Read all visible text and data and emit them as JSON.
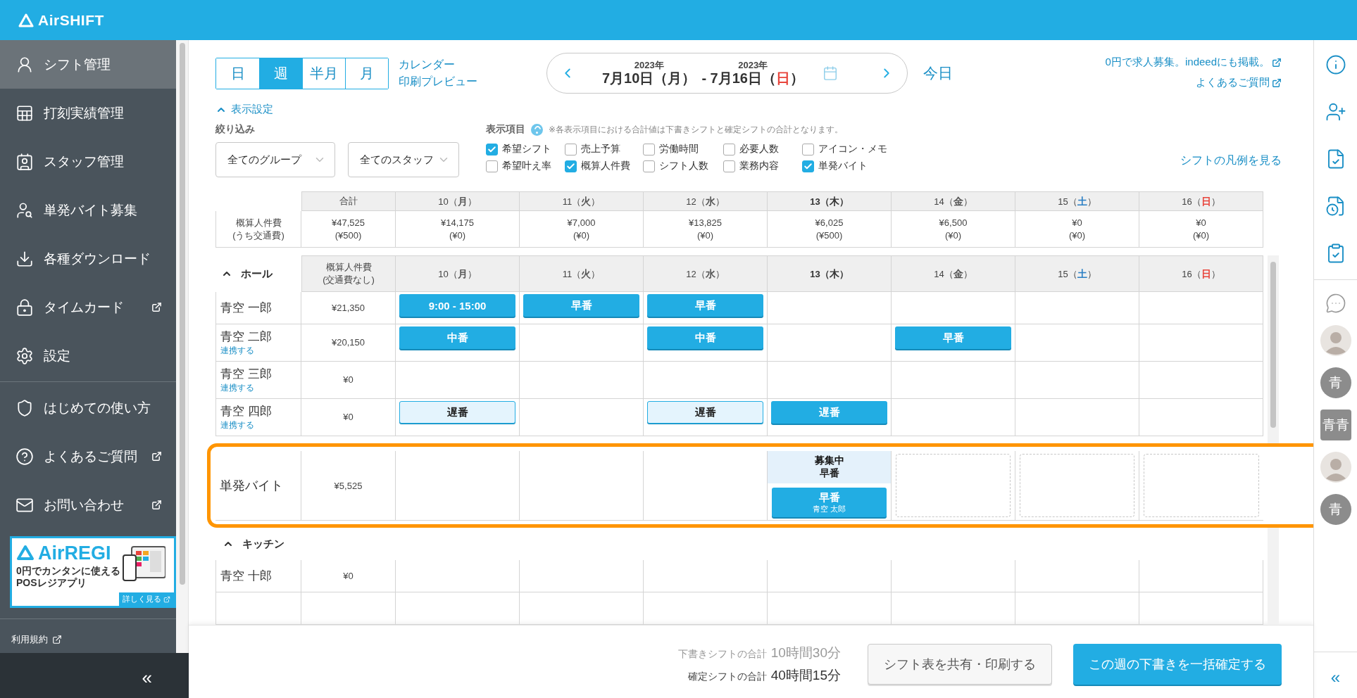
{
  "header": {
    "logo": "AirSHIFT"
  },
  "sidebar": {
    "sections": [
      [
        {
          "label": "シフト管理",
          "selected": true,
          "external": false
        },
        {
          "label": "打刻実績管理",
          "selected": false,
          "external": false
        },
        {
          "label": "スタッフ管理",
          "selected": false,
          "external": false
        },
        {
          "label": "単発バイト募集",
          "selected": false,
          "external": false
        },
        {
          "label": "各種ダウンロード",
          "selected": false,
          "external": false
        },
        {
          "label": "タイムカード",
          "selected": false,
          "external": true
        },
        {
          "label": "設定",
          "selected": false,
          "external": false
        }
      ],
      [
        {
          "label": "はじめての使い方",
          "selected": false,
          "external": false
        },
        {
          "label": "よくあるご質問",
          "selected": false,
          "external": true
        },
        {
          "label": "お問い合わせ",
          "selected": false,
          "external": true
        }
      ]
    ],
    "banner": {
      "brand": "AirREGI",
      "lines": [
        "0円でカンタンに使える",
        "POSレジアプリ"
      ],
      "link": "詳しく見る"
    },
    "footer_link": "利用規約",
    "collapse": "«"
  },
  "toolbar": {
    "view_tabs": [
      {
        "label": "日",
        "selected": false
      },
      {
        "label": "週",
        "selected": true
      },
      {
        "label": "半月",
        "selected": false
      },
      {
        "label": "月",
        "selected": false
      }
    ],
    "print_link": [
      "カレンダー",
      "印刷プレビュー"
    ],
    "range": {
      "start_year": "2023年",
      "start": "7月10日（月）",
      "end_year": "2023年",
      "end": "- 7月16日（",
      "end_weekday": "日",
      "end_close": "）"
    },
    "today": "今日",
    "links": [
      "0円で求人募集。indeedにも掲載。",
      "よくあるご質問"
    ]
  },
  "display_settings": {
    "toggle": "表示設定",
    "expanded": true,
    "filter_label": "絞り込み",
    "filters": [
      "全てのグループ",
      "全てのスタッフ"
    ],
    "items_label": "表示項目",
    "note": "※各表示項目における合計値は下書きシフトと確定シフトの合計となります。",
    "options": [
      {
        "label": "希望シフト",
        "checked": true
      },
      {
        "label": "売上予算",
        "checked": false
      },
      {
        "label": "労働時間",
        "checked": false
      },
      {
        "label": "必要人数",
        "checked": false
      },
      {
        "label": "アイコン・メモ",
        "checked": false
      },
      {
        "label": "希望叶え率",
        "checked": false
      },
      {
        "label": "概算人件費",
        "checked": true
      },
      {
        "label": "シフト人数",
        "checked": false
      },
      {
        "label": "業務内容",
        "checked": false
      },
      {
        "label": "単発バイト",
        "checked": true
      }
    ],
    "legend_link": "シフトの凡例を見る"
  },
  "summary": {
    "total_header": "合計",
    "days": [
      {
        "day": "10（",
        "weekday": "月",
        "close": "）",
        "color": "#555555",
        "today": false
      },
      {
        "day": "11（",
        "weekday": "火",
        "close": "）",
        "color": "#555555",
        "today": false
      },
      {
        "day": "12（",
        "weekday": "水",
        "close": "）",
        "color": "#555555",
        "today": false
      },
      {
        "day": "13（",
        "weekday": "木",
        "close": "）",
        "color": "#333333",
        "today": true
      },
      {
        "day": "14（",
        "weekday": "金",
        "close": "）",
        "color": "#555555",
        "today": false
      },
      {
        "day": "15（",
        "weekday": "土",
        "close": "）",
        "color": "#2a7fc4",
        "today": false
      },
      {
        "day": "16（",
        "weekday": "日",
        "close": "）",
        "color": "#e8453c",
        "today": false
      }
    ],
    "row_label": [
      "概算人件費",
      "(うち交通費)"
    ],
    "values": [
      {
        "amount": "¥47,525",
        "sub": "(¥500)"
      },
      {
        "amount": "¥14,175",
        "sub": "(¥0)"
      },
      {
        "amount": "¥7,000",
        "sub": "(¥0)"
      },
      {
        "amount": "¥13,825",
        "sub": "(¥0)"
      },
      {
        "amount": "¥6,025",
        "sub": "(¥500)"
      },
      {
        "amount": "¥6,500",
        "sub": "(¥0)"
      },
      {
        "amount": "¥0",
        "sub": "(¥0)"
      },
      {
        "amount": "¥0",
        "sub": "(¥0)"
      }
    ]
  },
  "groups": [
    {
      "name": "ホール",
      "expanded": true,
      "cost_header": [
        "概算人件費",
        "(交通費なし)"
      ],
      "days": [
        {
          "day": "10（",
          "weekday": "月",
          "close": "）",
          "color": "#555555",
          "today": false
        },
        {
          "day": "11（",
          "weekday": "火",
          "close": "）",
          "color": "#555555",
          "today": false
        },
        {
          "day": "12（",
          "weekday": "水",
          "close": "）",
          "color": "#555555",
          "today": false
        },
        {
          "day": "13（",
          "weekday": "木",
          "close": "）",
          "color": "#333333",
          "today": true
        },
        {
          "day": "14（",
          "weekday": "金",
          "close": "）",
          "color": "#555555",
          "today": false
        },
        {
          "day": "15（",
          "weekday": "土",
          "close": "）",
          "color": "#2a7fc4",
          "today": false
        },
        {
          "day": "16（",
          "weekday": "日",
          "close": "）",
          "color": "#e8453c",
          "today": false
        }
      ],
      "staff": [
        {
          "name": "青空 一郎",
          "cost": "¥21,350",
          "shifts": [
            {
              "kind": "confirmed",
              "label": "9:00 - 15:00"
            },
            {
              "kind": "confirmed",
              "label": "早番"
            },
            {
              "kind": "confirmed",
              "label": "早番"
            },
            {
              "kind": "empty"
            },
            {
              "kind": "empty"
            },
            {
              "kind": "empty"
            },
            {
              "kind": "empty"
            }
          ]
        },
        {
          "name": "青空 二郎",
          "link": "連携する",
          "cost": "¥20,150",
          "shifts": [
            {
              "kind": "confirmed",
              "label": "中番"
            },
            {
              "kind": "empty"
            },
            {
              "kind": "confirmed",
              "label": "中番"
            },
            {
              "kind": "empty"
            },
            {
              "kind": "confirmed",
              "label": "早番"
            },
            {
              "kind": "empty"
            },
            {
              "kind": "empty"
            }
          ]
        },
        {
          "name": "青空 三郎",
          "link": "連携する",
          "cost": "¥0",
          "shifts": [
            {
              "kind": "empty"
            },
            {
              "kind": "empty"
            },
            {
              "kind": "empty"
            },
            {
              "kind": "empty"
            },
            {
              "kind": "empty"
            },
            {
              "kind": "empty"
            },
            {
              "kind": "empty"
            }
          ]
        },
        {
          "name": "青空 四郎",
          "link": "連携する",
          "cost": "¥0",
          "shifts": [
            {
              "kind": "draft",
              "label": "遅番"
            },
            {
              "kind": "empty"
            },
            {
              "kind": "draft",
              "label": "遅番"
            },
            {
              "kind": "confirmed",
              "label": "遅番"
            },
            {
              "kind": "empty"
            },
            {
              "kind": "empty"
            },
            {
              "kind": "empty"
            }
          ]
        }
      ],
      "spot": {
        "label": "単発バイト",
        "cost": "¥5,525",
        "highlighted": true,
        "cells": [
          {
            "kind": "blank"
          },
          {
            "kind": "blank"
          },
          {
            "kind": "blank"
          },
          {
            "kind": "recruiting",
            "status": "募集中",
            "shift": "早番",
            "assigned": {
              "label": "早番",
              "staff": "青空 太郎"
            }
          },
          {
            "kind": "slot"
          },
          {
            "kind": "slot"
          },
          {
            "kind": "slot"
          }
        ]
      }
    },
    {
      "name": "キッチン",
      "expanded": true,
      "staff": [
        {
          "name": "青空 十郎",
          "cost": "¥0",
          "shifts": [
            {
              "kind": "empty"
            },
            {
              "kind": "empty"
            },
            {
              "kind": "empty"
            },
            {
              "kind": "empty"
            },
            {
              "kind": "empty"
            },
            {
              "kind": "empty"
            },
            {
              "kind": "empty"
            }
          ]
        },
        {
          "shifts": [
            {
              "kind": "empty"
            },
            {
              "kind": "empty"
            },
            {
              "kind": "empty"
            },
            {
              "kind": "empty"
            },
            {
              "kind": "empty"
            },
            {
              "kind": "empty"
            },
            {
              "kind": "empty"
            }
          ]
        }
      ]
    }
  ],
  "footer": {
    "totals": [
      {
        "kind": "draft",
        "label": "下書きシフトの合計",
        "value": "10時間30分"
      },
      {
        "kind": "confirmed",
        "label": "確定シフトの合計",
        "value": "40時間15分"
      }
    ],
    "buttons": [
      {
        "kind": "secondary",
        "label": "シフト表を共有・印刷する"
      },
      {
        "kind": "primary",
        "label": "この週の下書きを一括確定する"
      }
    ]
  },
  "rail": {
    "avatars": [
      {
        "kind": "photo"
      },
      {
        "kind": "initial",
        "text": "青"
      },
      {
        "kind": "group",
        "text": "青青"
      },
      {
        "kind": "photo"
      },
      {
        "kind": "initial",
        "text": "青"
      }
    ],
    "collapse": "«"
  }
}
